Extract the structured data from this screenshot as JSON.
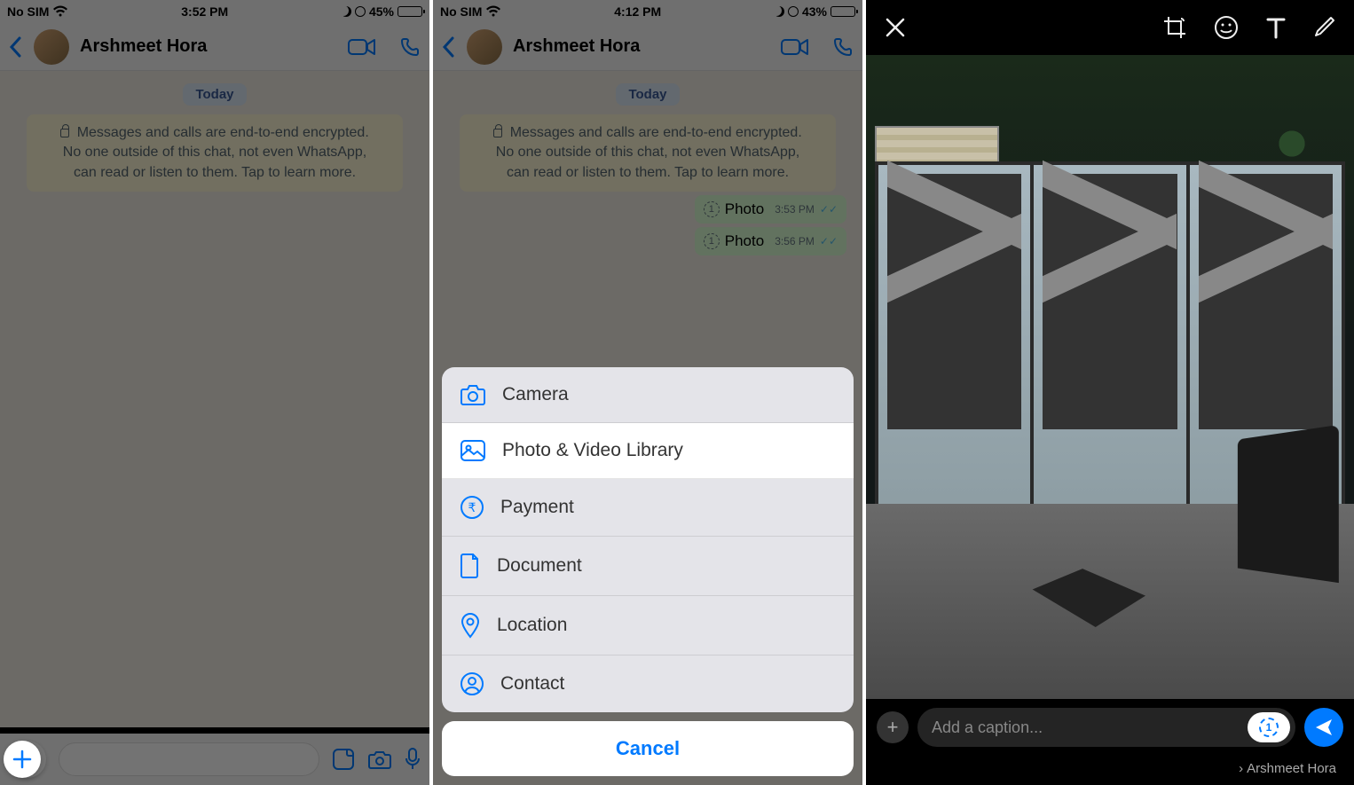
{
  "screen1": {
    "status": {
      "sim": "No SIM",
      "time": "3:52 PM",
      "battery_pct": "45%",
      "battery_fill": 45
    },
    "contact": "Arshmeet Hora",
    "date_badge": "Today",
    "encryption_note": "Messages and calls are end-to-end encrypted. No one outside of this chat, not even WhatsApp, can read or listen to them. Tap to learn more."
  },
  "screen2": {
    "status": {
      "sim": "No SIM",
      "time": "4:12 PM",
      "battery_pct": "43%",
      "battery_fill": 43
    },
    "contact": "Arshmeet Hora",
    "date_badge": "Today",
    "encryption_note": "Messages and calls are end-to-end encrypted. No one outside of this chat, not even WhatsApp, can read or listen to them. Tap to learn more.",
    "messages": [
      {
        "label": "Photo",
        "time": "3:53 PM"
      },
      {
        "label": "Photo",
        "time": "3:56 PM"
      }
    ],
    "sheet": {
      "items": [
        {
          "label": "Camera",
          "icon": "camera",
          "highlighted": false
        },
        {
          "label": "Photo & Video Library",
          "icon": "gallery",
          "highlighted": true
        },
        {
          "label": "Payment",
          "icon": "rupee",
          "highlighted": false
        },
        {
          "label": "Document",
          "icon": "document",
          "highlighted": false
        },
        {
          "label": "Location",
          "icon": "location",
          "highlighted": false
        },
        {
          "label": "Contact",
          "icon": "contact",
          "highlighted": false
        }
      ],
      "cancel": "Cancel"
    }
  },
  "screen3": {
    "caption_placeholder": "Add a caption...",
    "recipient": "Arshmeet Hora"
  }
}
